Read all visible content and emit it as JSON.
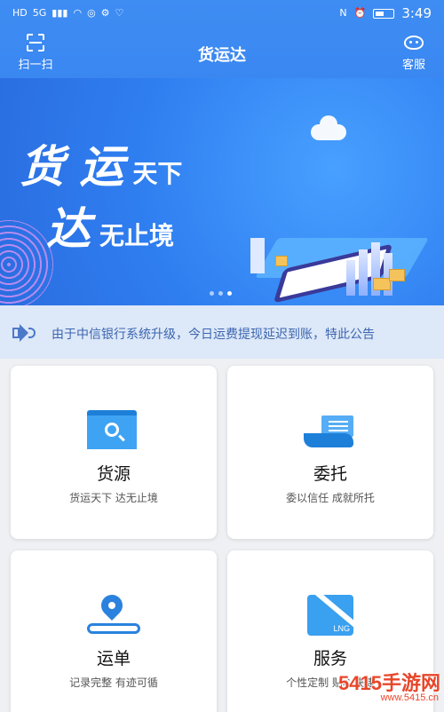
{
  "status_bar": {
    "left_icons": [
      "HD",
      "5G",
      "signal-icon",
      "wifi-icon",
      "status-icon",
      "status-icon",
      "heart-icon"
    ],
    "hd": "HD",
    "network": "5G",
    "time": "3:49"
  },
  "header": {
    "scan_label": "扫一扫",
    "title": "货运达",
    "service_label": "客服"
  },
  "banner": {
    "line1_big": "货 运",
    "line1_small": "天下",
    "line2_big": "达",
    "line2_small": "无止境",
    "page_count": 3,
    "active_page": 3
  },
  "notice": {
    "text": "由于中信银行系统升级，今日运费提现延迟到账，特此公告"
  },
  "cards": [
    {
      "name": "货源",
      "sub": "货运天下 达无止境",
      "icon": "search-box-icon"
    },
    {
      "name": "委托",
      "sub": "委以信任 成就所托",
      "icon": "hand-document-icon"
    },
    {
      "name": "运单",
      "sub": "记录完整 有迹可循",
      "icon": "location-pin-icon"
    },
    {
      "name": "服务",
      "sub": "个性定制 贴心快捷",
      "icon": "map-icon"
    }
  ],
  "watermark": {
    "main": "5415手游网",
    "sub": "www.5415.cn"
  },
  "colors": {
    "primary": "#3a87f1",
    "notice_bg": "#dde8f8",
    "notice_text": "#3c66b0"
  }
}
